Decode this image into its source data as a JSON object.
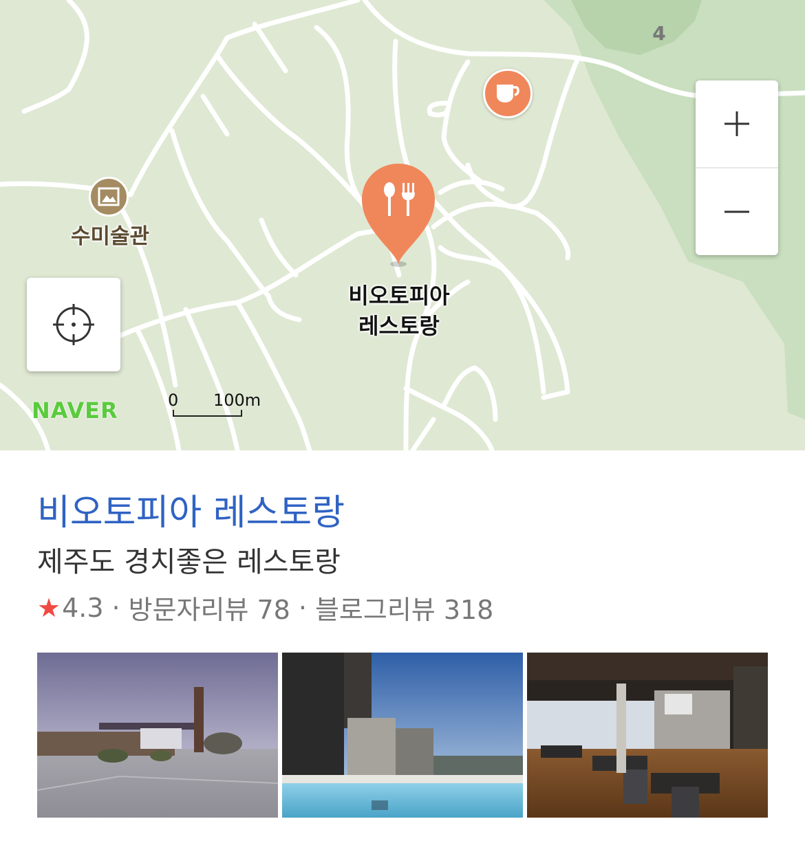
{
  "map": {
    "provider_logo": "NAVER",
    "road_number": "4",
    "scale": {
      "zero": "0",
      "distance": "100m"
    },
    "pois": {
      "gallery": {
        "label": "수미술관",
        "icon": "gallery-picture-icon"
      },
      "cafe": {
        "icon": "coffee-cup-icon"
      },
      "selected": {
        "label_line1": "비오토피아",
        "label_line2": "레스토랑",
        "icon": "fork-spoon-icon"
      }
    },
    "controls": {
      "zoom_in": "+",
      "zoom_out": "−",
      "locate_icon": "crosshair-icon"
    }
  },
  "place": {
    "name": "비오토피아 레스토랑",
    "description": "제주도 경치좋은 레스토랑",
    "rating": "4.3",
    "separator": "·",
    "visitor_reviews": "방문자리뷰 78",
    "blog_reviews": "블로그리뷰 318"
  },
  "photos": [
    {
      "subject": "building-exterior-photo"
    },
    {
      "subject": "pool-terrace-photo"
    },
    {
      "subject": "restaurant-interior-photo"
    }
  ],
  "colors": {
    "title": "#2f63c3",
    "star": "#f04a43",
    "poi_marker": "#f0875a",
    "naver_green": "#5acb3e",
    "map_bg": "#dfe8d3",
    "park_green": "#b9d8b0"
  }
}
